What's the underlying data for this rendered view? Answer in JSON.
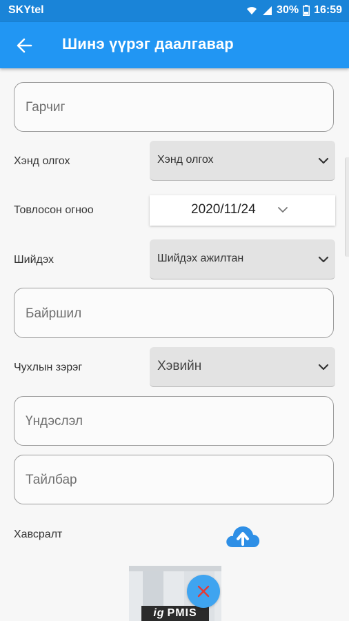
{
  "status_bar": {
    "carrier": "SKYtel",
    "battery": "30%",
    "time": "16:59"
  },
  "app_bar": {
    "title": "Шинэ үүрэг даалгавар"
  },
  "form": {
    "title_field": {
      "placeholder": "Гарчиг"
    },
    "assignee": {
      "label": "Хэнд олгох",
      "value": "Хэнд олгох"
    },
    "due_date": {
      "label": "Товлосон огноо",
      "value": "2020/11/24"
    },
    "resolver": {
      "label": "Шийдэх",
      "value": "Шийдэх ажилтан"
    },
    "location_field": {
      "placeholder": "Байршил"
    },
    "priority": {
      "label": "Чухлын зэрэг",
      "value": "Хэвийн"
    },
    "basis_field": {
      "placeholder": "Үндэслэл"
    },
    "description_field": {
      "placeholder": "Тайлбар"
    },
    "attachment": {
      "label": "Хавсралт"
    }
  },
  "thumbnail": {
    "logo_prefix": "ig",
    "logo_text": "PMIS"
  },
  "colors": {
    "primary": "#2196f3",
    "status_bar": "#1a84d8",
    "remove_button": "#3fa4f0",
    "remove_icon": "#e53935"
  }
}
